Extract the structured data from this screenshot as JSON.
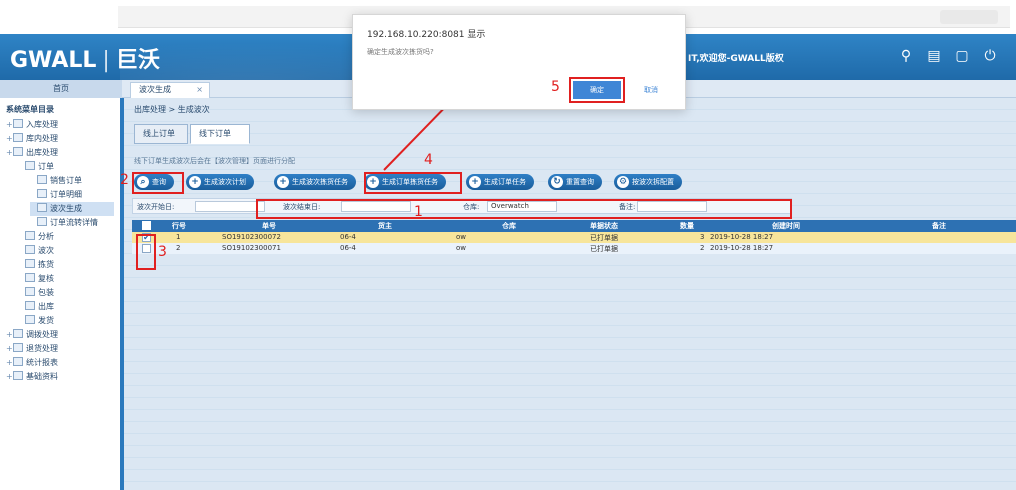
{
  "header": {
    "logo": "GWALL",
    "logo_cn": "巨沃",
    "user_text": "IT,欢迎您-GWALL版权"
  },
  "nav": {
    "home": "首页",
    "tab": "波次生成"
  },
  "sidebar": {
    "title": "系统菜单目录",
    "items": [
      {
        "label": "入库处理",
        "level": 0
      },
      {
        "label": "库内处理",
        "level": 0
      },
      {
        "label": "出库处理",
        "level": 0
      },
      {
        "label": "订单",
        "level": 1
      },
      {
        "label": "销售订单",
        "level": 2
      },
      {
        "label": "订单明细",
        "level": 2
      },
      {
        "label": "波次生成",
        "level": 2
      },
      {
        "label": "订单流转详情",
        "level": 2
      },
      {
        "label": "分析",
        "level": 1
      },
      {
        "label": "波次",
        "level": 1
      },
      {
        "label": "拣货",
        "level": 1
      },
      {
        "label": "复核",
        "level": 1
      },
      {
        "label": "包装",
        "level": 1
      },
      {
        "label": "出库",
        "level": 1
      },
      {
        "label": "发货",
        "level": 1
      },
      {
        "label": "调拨处理",
        "level": 0
      },
      {
        "label": "退货处理",
        "level": 0
      },
      {
        "label": "统计报表",
        "level": 0
      },
      {
        "label": "基础资料",
        "level": 0
      }
    ]
  },
  "main": {
    "breadcrumb": "出库处理 > 生成波次",
    "tabs": [
      "线上订单",
      "线下订单"
    ],
    "tip": "线下订单生成波次后会在【波次管理】页面进行分配",
    "buttons": [
      {
        "label": "查询",
        "icon": "search-icon"
      },
      {
        "label": "生成波次计划",
        "icon": "plus-icon"
      },
      {
        "label": "生成波次拣货任务",
        "icon": "plus-icon"
      },
      {
        "label": "生成订单拣货任务",
        "icon": "plus-icon"
      },
      {
        "label": "生成订单任务",
        "icon": "plus-icon"
      },
      {
        "label": "重置查询",
        "icon": "refresh-icon"
      },
      {
        "label": "按波次拆配置",
        "icon": "gear-icon"
      }
    ],
    "filter": {
      "label1": "波次开始日:",
      "label2": "波次结束日:",
      "label3": "仓库:",
      "select3": "Overwatch",
      "label4": "备注:"
    },
    "columns": [
      "行号",
      "单号",
      "货主",
      "仓库",
      "单据状态",
      "数量",
      "创建时间",
      "备注"
    ],
    "rows": [
      {
        "no": "1",
        "order": "SO19102300072",
        "owner": "06-4",
        "wh": "ow",
        "status": "已打单据",
        "qty": "3",
        "time": "2019-10-28 18:27",
        "checked": true
      },
      {
        "no": "2",
        "order": "SO19102300071",
        "owner": "06-4",
        "wh": "ow",
        "status": "已打单据",
        "qty": "2",
        "time": "2019-10-28 18:27",
        "checked": false
      }
    ]
  },
  "dialog": {
    "title": "192.168.10.220:8081 显示",
    "message": "确定生成波次拣货吗?",
    "ok": "确定",
    "cancel": "取消"
  },
  "annotations": [
    "1",
    "2",
    "3",
    "4",
    "5"
  ],
  "colors": {
    "header": "#2f84c6",
    "accent": "#2d71b3",
    "selected_row": "#f7e59b",
    "annotation_red": "#e02020"
  }
}
